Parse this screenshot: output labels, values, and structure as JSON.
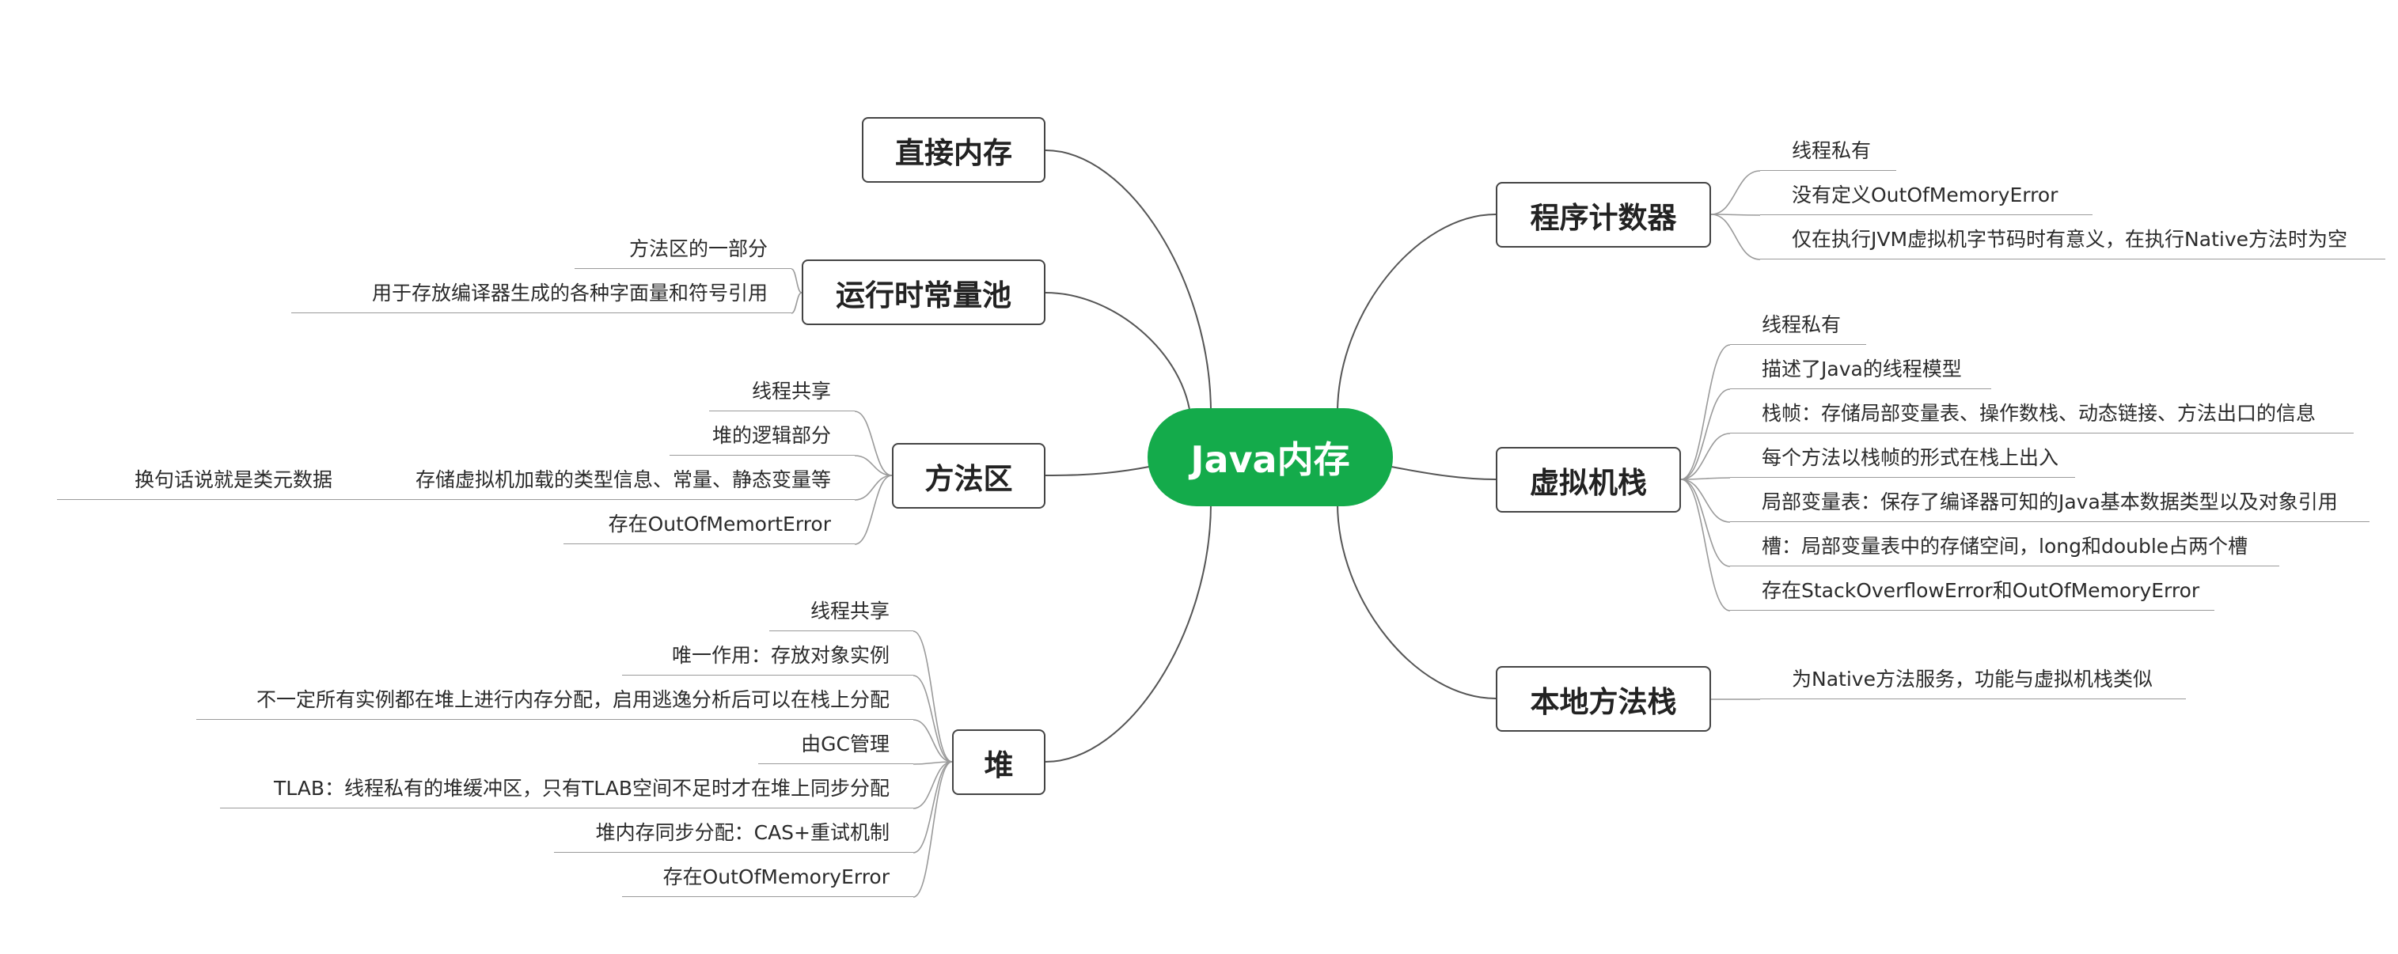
{
  "central": {
    "label": "Java内存",
    "color": "#14ab4b"
  },
  "branches": [
    {
      "id": "direct",
      "label": "直接内存",
      "items": []
    },
    {
      "id": "pool",
      "label": "运行时常量池",
      "items": [
        "方法区的一部分",
        "用于存放编译器生成的各种字面量和符号引用"
      ]
    },
    {
      "id": "method",
      "label": "方法区",
      "items": [
        "线程共享",
        "堆的逻辑部分",
        "存储虚拟机加载的类型信息、常量、静态变量等",
        "存在OutOfMemortError"
      ],
      "sub_items": [
        "换句话说就是类元数据"
      ]
    },
    {
      "id": "heap",
      "label": "堆",
      "items": [
        "线程共享",
        "唯一作用：存放对象实例",
        "不一定所有实例都在堆上进行内存分配，启用逃逸分析后可以在栈上分配",
        "由GC管理",
        "TLAB：线程私有的堆缓冲区，只有TLAB空间不足时才在堆上同步分配",
        "堆内存同步分配：CAS+重试机制",
        "存在OutOfMemoryError"
      ]
    },
    {
      "id": "pc",
      "label": "程序计数器",
      "items": [
        "线程私有",
        "没有定义OutOfMemoryError",
        "仅在执行JVM虚拟机字节码时有意义，在执行Native方法时为空"
      ]
    },
    {
      "id": "vmstack",
      "label": "虚拟机栈",
      "items": [
        "线程私有",
        "描述了Java的线程模型",
        "栈帧：存储局部变量表、操作数栈、动态链接、方法出口的信息",
        "每个方法以栈帧的形式在栈上出入",
        "局部变量表：保存了编译器可知的Java基本数据类型以及对象引用",
        "槽：局部变量表中的存储空间，long和double占两个槽",
        "存在StackOverflowError和OutOfMemoryError"
      ]
    },
    {
      "id": "native",
      "label": "本地方法栈",
      "items": [
        "为Native方法服务，功能与虚拟机栈类似"
      ]
    }
  ]
}
